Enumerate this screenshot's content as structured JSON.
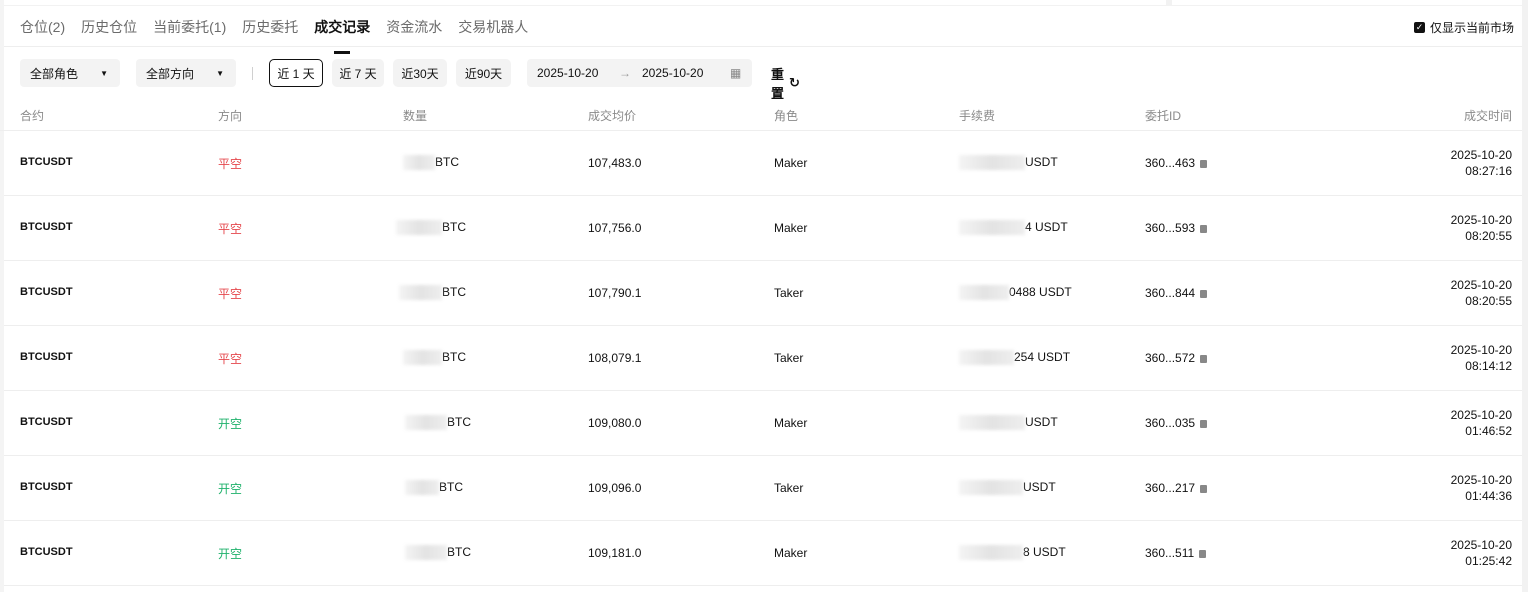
{
  "tabs": [
    {
      "label": "仓位(2)"
    },
    {
      "label": "历史仓位"
    },
    {
      "label": "当前委托(1)"
    },
    {
      "label": "历史委托"
    },
    {
      "label": "成交记录",
      "active": true
    },
    {
      "label": "资金流水"
    },
    {
      "label": "交易机器人"
    }
  ],
  "only_current_market": {
    "label": "仅显示当前市场",
    "checked": true,
    "check_glyph": "✓"
  },
  "filters": {
    "role_select": "全部角色",
    "direction_select": "全部方向",
    "ranges": [
      "近 1 天",
      "近 7 天",
      "近30天",
      "近90天"
    ],
    "active_range": "近 1 天",
    "date_from": "2025-10-20",
    "date_to": "2025-10-20",
    "arrow": "→",
    "calendar_glyph": "▦",
    "reset_label": "重置",
    "reset_glyph": "↻",
    "caret": "▼"
  },
  "table": {
    "columns": [
      "合约",
      "方向",
      "数量",
      "成交均价",
      "角色",
      "手续费",
      "委托ID",
      "成交时间"
    ],
    "rows": [
      {
        "symbol": "BTCUSDT",
        "side": "平空",
        "side_color": "#e5484d",
        "qty_visible": "BTC",
        "price": "107,483.0",
        "role": "Maker",
        "fee_visible": "USDT",
        "order_id": "360...463",
        "date": "2025-10-20",
        "time": "08:27:16"
      },
      {
        "symbol": "BTCUSDT",
        "side": "平空",
        "side_color": "#e5484d",
        "qty_visible": "BTC",
        "price": "107,756.0",
        "role": "Maker",
        "fee_visible": "4 USDT",
        "order_id": "360...593",
        "date": "2025-10-20",
        "time": "08:20:55"
      },
      {
        "symbol": "BTCUSDT",
        "side": "平空",
        "side_color": "#e5484d",
        "qty_visible": "BTC",
        "price": "107,790.1",
        "role": "Taker",
        "fee_visible": "0488 USDT",
        "order_id": "360...844",
        "date": "2025-10-20",
        "time": "08:20:55"
      },
      {
        "symbol": "BTCUSDT",
        "side": "平空",
        "side_color": "#e5484d",
        "qty_visible": "BTC",
        "price": "108,079.1",
        "role": "Taker",
        "fee_visible": "254 USDT",
        "order_id": "360...572",
        "date": "2025-10-20",
        "time": "08:14:12"
      },
      {
        "symbol": "BTCUSDT",
        "side": "开空",
        "side_color": "#20b26c",
        "qty_visible": "BTC",
        "price": "109,080.0",
        "role": "Maker",
        "fee_visible": "USDT",
        "order_id": "360...035",
        "date": "2025-10-20",
        "time": "01:46:52"
      },
      {
        "symbol": "BTCUSDT",
        "side": "开空",
        "side_color": "#20b26c",
        "qty_visible": "BTC",
        "price": "109,096.0",
        "role": "Taker",
        "fee_visible": "USDT",
        "order_id": "360...217",
        "date": "2025-10-20",
        "time": "01:44:36"
      },
      {
        "symbol": "BTCUSDT",
        "side": "开空",
        "side_color": "#20b26c",
        "qty_visible": "BTC",
        "price": "109,181.0",
        "role": "Maker",
        "fee_visible": "8 USDT",
        "order_id": "360...511",
        "date": "2025-10-20",
        "time": "01:25:42"
      }
    ]
  }
}
